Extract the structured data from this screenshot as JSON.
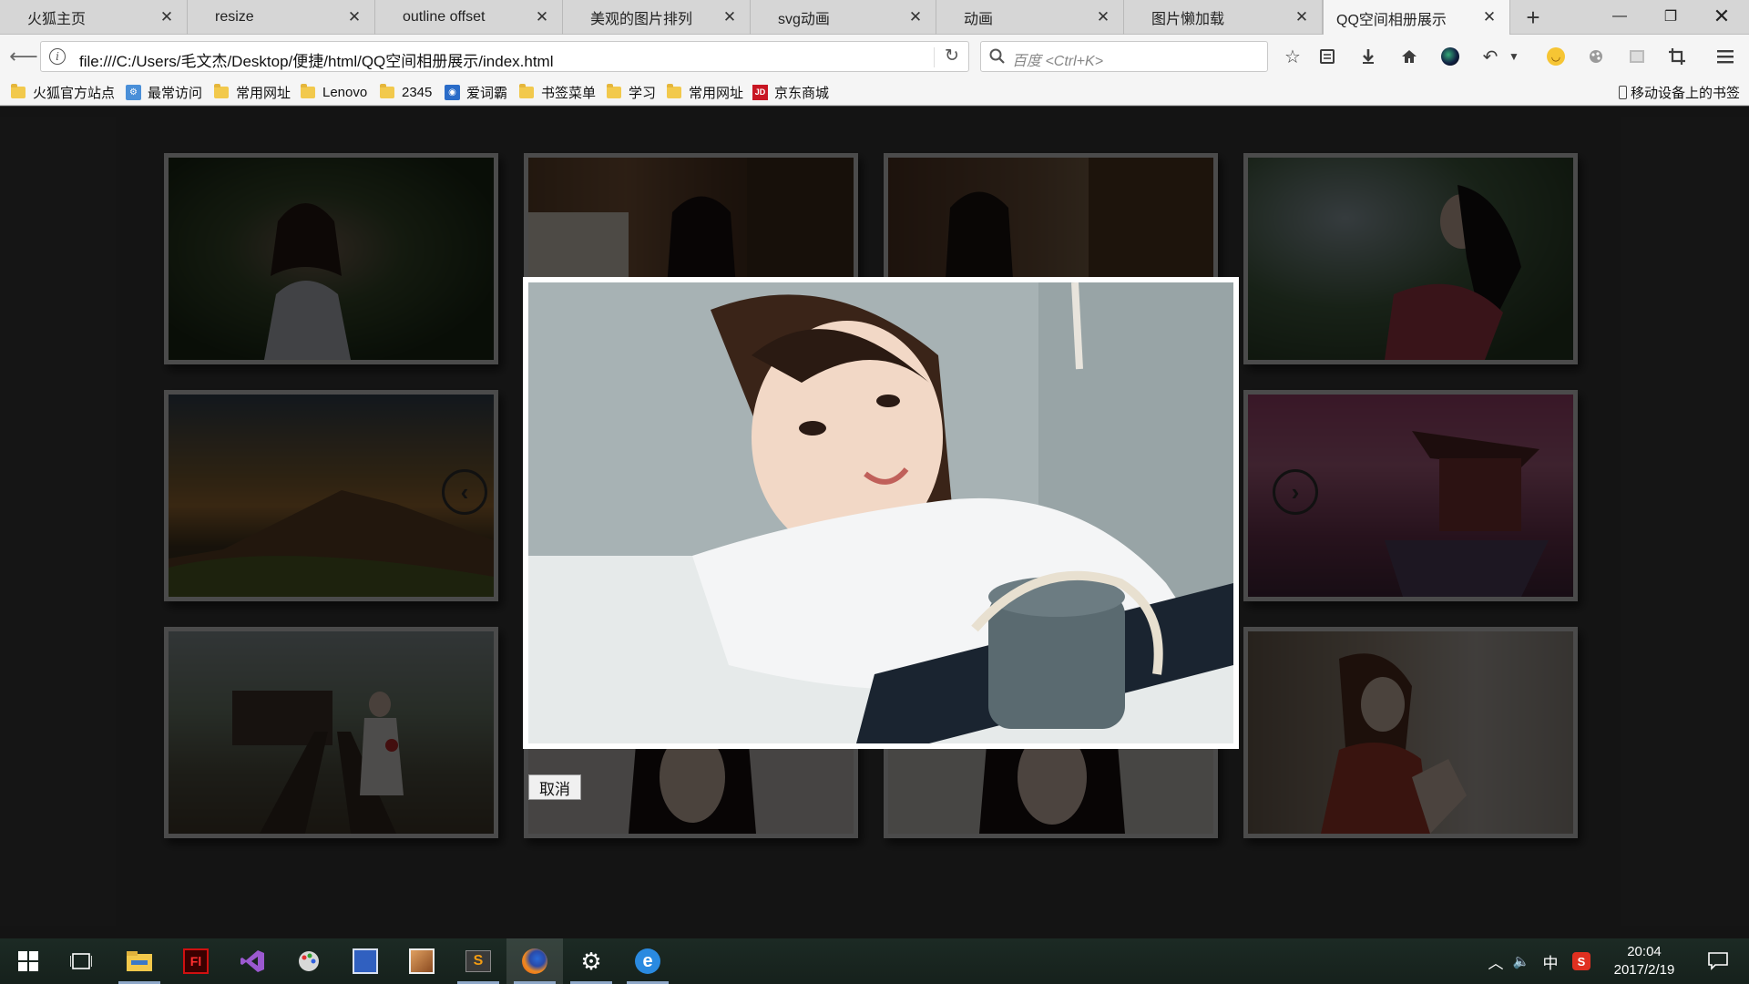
{
  "browser": {
    "tabs": [
      {
        "title": "火狐主页",
        "active": false
      },
      {
        "title": "resize",
        "active": false
      },
      {
        "title": "outline offset",
        "active": false
      },
      {
        "title": "美观的图片排列",
        "active": false
      },
      {
        "title": "svg动画",
        "active": false
      },
      {
        "title": "动画",
        "active": false
      },
      {
        "title": "图片懒加载",
        "active": false
      },
      {
        "title": "QQ空间相册展示",
        "active": true
      }
    ],
    "url": "file:///C:/Users/毛文杰/Desktop/便捷/html/QQ空间相册展示/index.html",
    "search_placeholder": "百度 <Ctrl+K>",
    "bookmarks": [
      {
        "label": "火狐官方站点",
        "icon": "folder-icon"
      },
      {
        "label": "最常访问",
        "icon": "smart-folder-icon"
      },
      {
        "label": "常用网址",
        "icon": "folder-icon"
      },
      {
        "label": "Lenovo",
        "icon": "folder-icon"
      },
      {
        "label": "2345",
        "icon": "folder-icon"
      },
      {
        "label": "爱词霸",
        "icon": "iciba-icon"
      },
      {
        "label": "书签菜单",
        "icon": "folder-icon"
      },
      {
        "label": "学习",
        "icon": "folder-icon"
      },
      {
        "label": "常用网址",
        "icon": "folder-icon"
      },
      {
        "label": "京东商城",
        "icon": "jd-icon"
      }
    ],
    "mobile_bookmarks": "移动设备上的书签"
  },
  "gallery": {
    "thumbnails": [
      {
        "name": "girl-in-forest",
        "row": 1,
        "col": 1
      },
      {
        "name": "girl-in-library",
        "row": 1,
        "col": 2
      },
      {
        "name": "girl-at-bookshelf",
        "row": 1,
        "col": 3
      },
      {
        "name": "girl-among-pines",
        "row": 1,
        "col": 4
      },
      {
        "name": "mountain-sunset",
        "row": 2,
        "col": 1
      },
      {
        "name": "cherry-blossom-temple",
        "row": 2,
        "col": 4
      },
      {
        "name": "girl-on-railway",
        "row": 3,
        "col": 1
      },
      {
        "name": "girl-portrait-dark-hair",
        "row": 3,
        "col": 2
      },
      {
        "name": "girl-portrait-dark-hair-2",
        "row": 3,
        "col": 3
      },
      {
        "name": "girl-with-scarf",
        "row": 3,
        "col": 4
      }
    ],
    "prev_icon": "chevron-left-icon",
    "next_icon": "chevron-right-icon",
    "preview": {
      "name": "smiling-girl-leaning-on-arms"
    },
    "cancel_label": "取消"
  },
  "taskbar": {
    "apps": [
      "start",
      "task-view",
      "file-explorer",
      "flash",
      "visual-studio",
      "paint",
      "app-5",
      "photo-app",
      "sublime-text",
      "firefox",
      "settings",
      "internet-explorer"
    ],
    "ime": "中",
    "clock_time": "20:04",
    "clock_date": "2017/2/19"
  },
  "colors": {
    "tab_strip": "#d6d6d6",
    "toolbar": "#f5f5f5",
    "page_bg": "#404040",
    "overlay": "rgba(0,0,0,0.68)",
    "taskbar": "#1c2a24"
  }
}
